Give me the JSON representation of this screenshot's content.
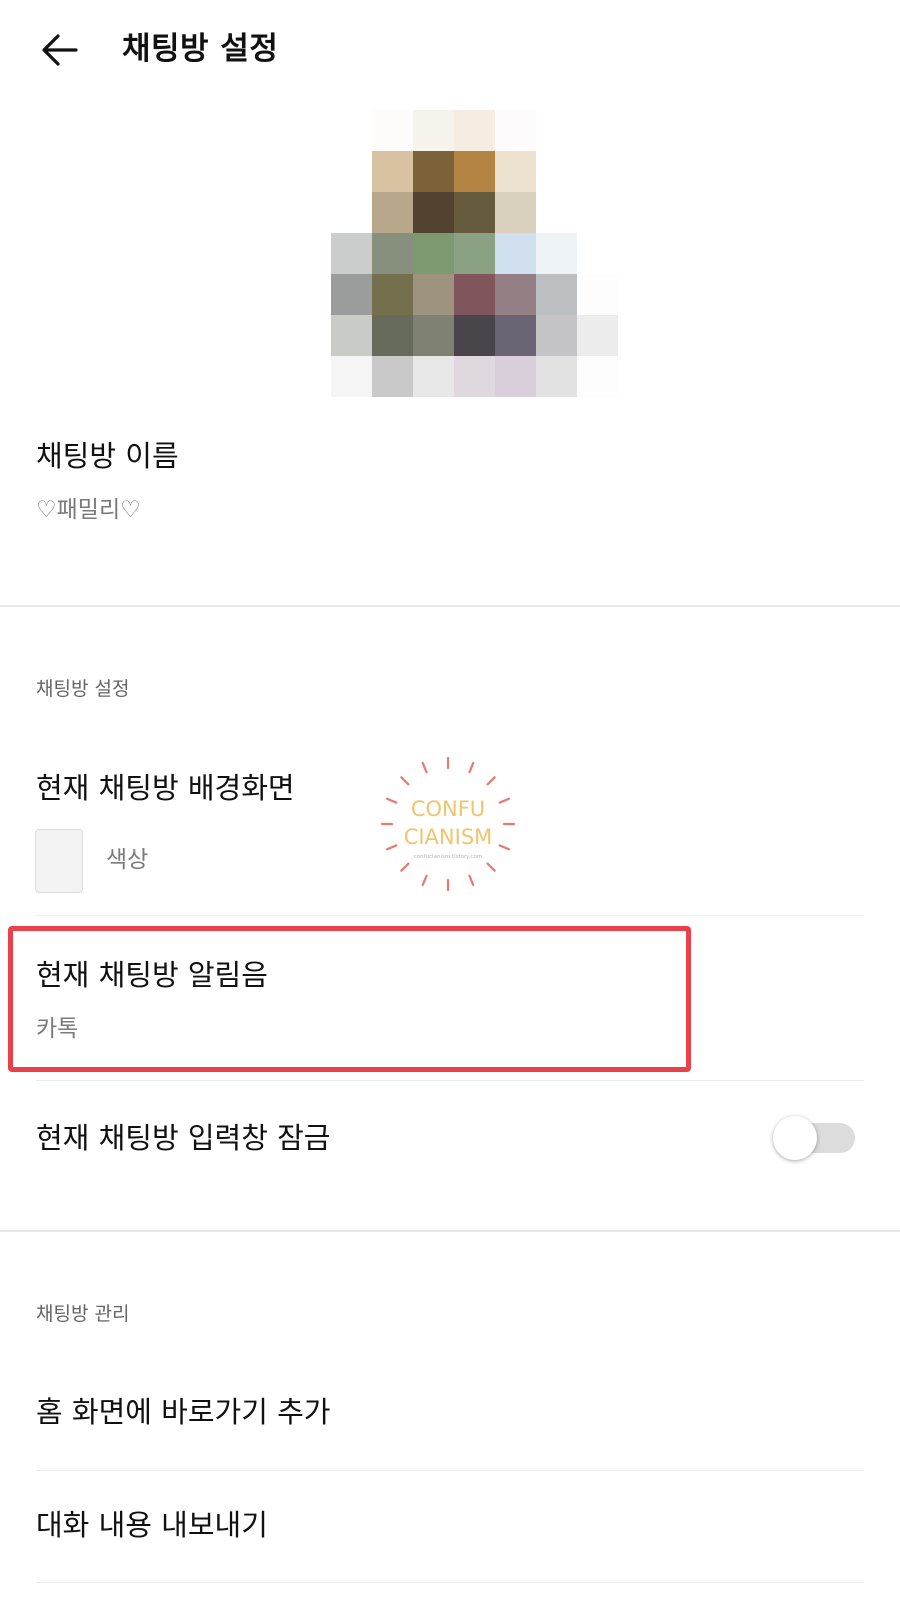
{
  "header": {
    "title": "채팅방 설정",
    "back_icon": "arrow-left-icon"
  },
  "profile": {
    "pixels": [
      [
        "#ffffff",
        "#fdfcfb",
        "#f6f2ec",
        "#f5ede1",
        "#fdfbfb",
        "#ffffff",
        "#ffffff"
      ],
      [
        "#ffffff",
        "#d9c2a2",
        "#7c6238",
        "#b48444",
        "#ede2d0",
        "#ffffff",
        "#ffffff"
      ],
      [
        "#ffffff",
        "#b8a78a",
        "#544230",
        "#655a3c",
        "#d9d1bd",
        "#ffffff",
        "#ffffff"
      ],
      [
        "#cbcccc",
        "#87907c",
        "#7c9970",
        "#8aa283",
        "#cfdfee",
        "#eef3f8",
        "#ffffff"
      ],
      [
        "#9a9d9b",
        "#74704e",
        "#9e937e",
        "#80555c",
        "#947f85",
        "#bcc0c2",
        "#fdfdfd"
      ],
      [
        "#c9cbc6",
        "#676b5c",
        "#7f8173",
        "#49454b",
        "#6b6474",
        "#c4c4c6",
        "#ececec"
      ],
      [
        "#f5f5f5",
        "#c9c9c9",
        "#e8e8e8",
        "#e0d8df",
        "#d8cfdb",
        "#e2e2e2",
        "#fdfdfd"
      ]
    ]
  },
  "room_name": {
    "title": "채팅방 이름",
    "value": "♡패밀리♡"
  },
  "settings_section": {
    "label": "채팅방 설정",
    "background": {
      "title": "현재 채팅방 배경화면",
      "value": "색상",
      "swatch_color": "#f3f3f3"
    },
    "notification": {
      "title": "현재 채팅방 알림음",
      "value": "카톡"
    },
    "input_lock": {
      "title": "현재 채팅방 입력창 잠금",
      "enabled": false
    }
  },
  "manage_section": {
    "label": "채팅방 관리",
    "items": [
      {
        "label": "홈 화면에 바로가기 추가"
      },
      {
        "label": "대화 내용 내보내기"
      }
    ]
  },
  "watermark": {
    "line1": "CONFU",
    "line2": "CIANISM",
    "url": "confucianism.tistory.com",
    "text_color": "#f2c36b",
    "ray_color": "#e87a6a"
  },
  "highlight_color": "#e8414a"
}
